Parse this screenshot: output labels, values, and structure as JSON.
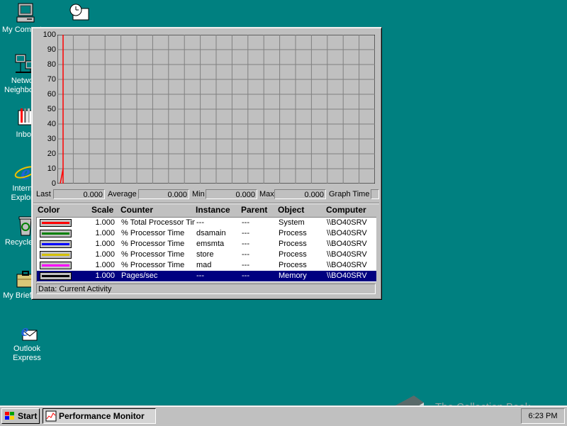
{
  "desktop": {
    "icons": [
      {
        "label": "My Computer",
        "icon": "computer-icon"
      },
      {
        "label": "Network Neighborhood",
        "icon": "network-icon"
      },
      {
        "label": "Inbox",
        "icon": "inbox-icon"
      },
      {
        "label": "Internet Explorer",
        "icon": "ie-icon"
      },
      {
        "label": "Recycle Bin",
        "icon": "recycle-bin-icon"
      },
      {
        "label": "My Briefcase",
        "icon": "briefcase-icon"
      },
      {
        "label": "Outlook Express",
        "icon": "outlook-express-icon"
      },
      {
        "label": "",
        "icon": "scheduler-icon"
      }
    ]
  },
  "perfmon": {
    "y_ticks": [
      "100",
      "90",
      "80",
      "70",
      "60",
      "50",
      "40",
      "30",
      "20",
      "10",
      "0"
    ],
    "y_range": [
      0,
      100
    ],
    "grid_columns": 20,
    "trace_color": "#ff0000",
    "trace_points": [
      [
        0,
        0
      ],
      [
        1,
        10
      ],
      [
        1,
        100
      ],
      [
        1,
        0
      ]
    ],
    "stats": {
      "last_label": "Last",
      "last_value": "0.000",
      "average_label": "Average",
      "average_value": "0.000",
      "min_label": "Min",
      "min_value": "0.000",
      "max_label": "Max",
      "max_value": "0.000",
      "graph_time_label": "Graph Time",
      "graph_time_value": ""
    },
    "legend_headers": {
      "color": "Color",
      "scale": "Scale",
      "counter": "Counter",
      "instance": "Instance",
      "parent": "Parent",
      "object": "Object",
      "computer": "Computer"
    },
    "legend_rows": [
      {
        "color": "#ff0000",
        "scale": "1.000",
        "counter": "% Total Processor Time",
        "instance": "---",
        "parent": "---",
        "object": "System",
        "computer": "\\\\BO40SRV"
      },
      {
        "color": "#008000",
        "scale": "1.000",
        "counter": "% Processor Time",
        "instance": "dsamain",
        "parent": "---",
        "object": "Process",
        "computer": "\\\\BO40SRV"
      },
      {
        "color": "#0000ff",
        "scale": "1.000",
        "counter": "% Processor Time",
        "instance": "emsmta",
        "parent": "---",
        "object": "Process",
        "computer": "\\\\BO40SRV"
      },
      {
        "color": "#d4c000",
        "scale": "1.000",
        "counter": "% Processor Time",
        "instance": "store",
        "parent": "---",
        "object": "Process",
        "computer": "\\\\BO40SRV"
      },
      {
        "color": "#ff00ff",
        "scale": "1.000",
        "counter": "% Processor Time",
        "instance": "mad",
        "parent": "---",
        "object": "Process",
        "computer": "\\\\BO40SRV"
      },
      {
        "color": "#000000",
        "scale": "1.000",
        "counter": "Pages/sec",
        "instance": "---",
        "parent": "---",
        "object": "Memory",
        "computer": "\\\\BO40SRV",
        "selected": true
      }
    ],
    "status_text": "Data: Current Activity"
  },
  "taskbar": {
    "start_label": "Start",
    "task_label": "Performance Monitor",
    "clock": "6:23 PM"
  },
  "watermark": {
    "text": "The Collection Book"
  },
  "colors": {
    "desktop": "#008080",
    "face": "#c0c0c0",
    "selection": "#000080"
  }
}
